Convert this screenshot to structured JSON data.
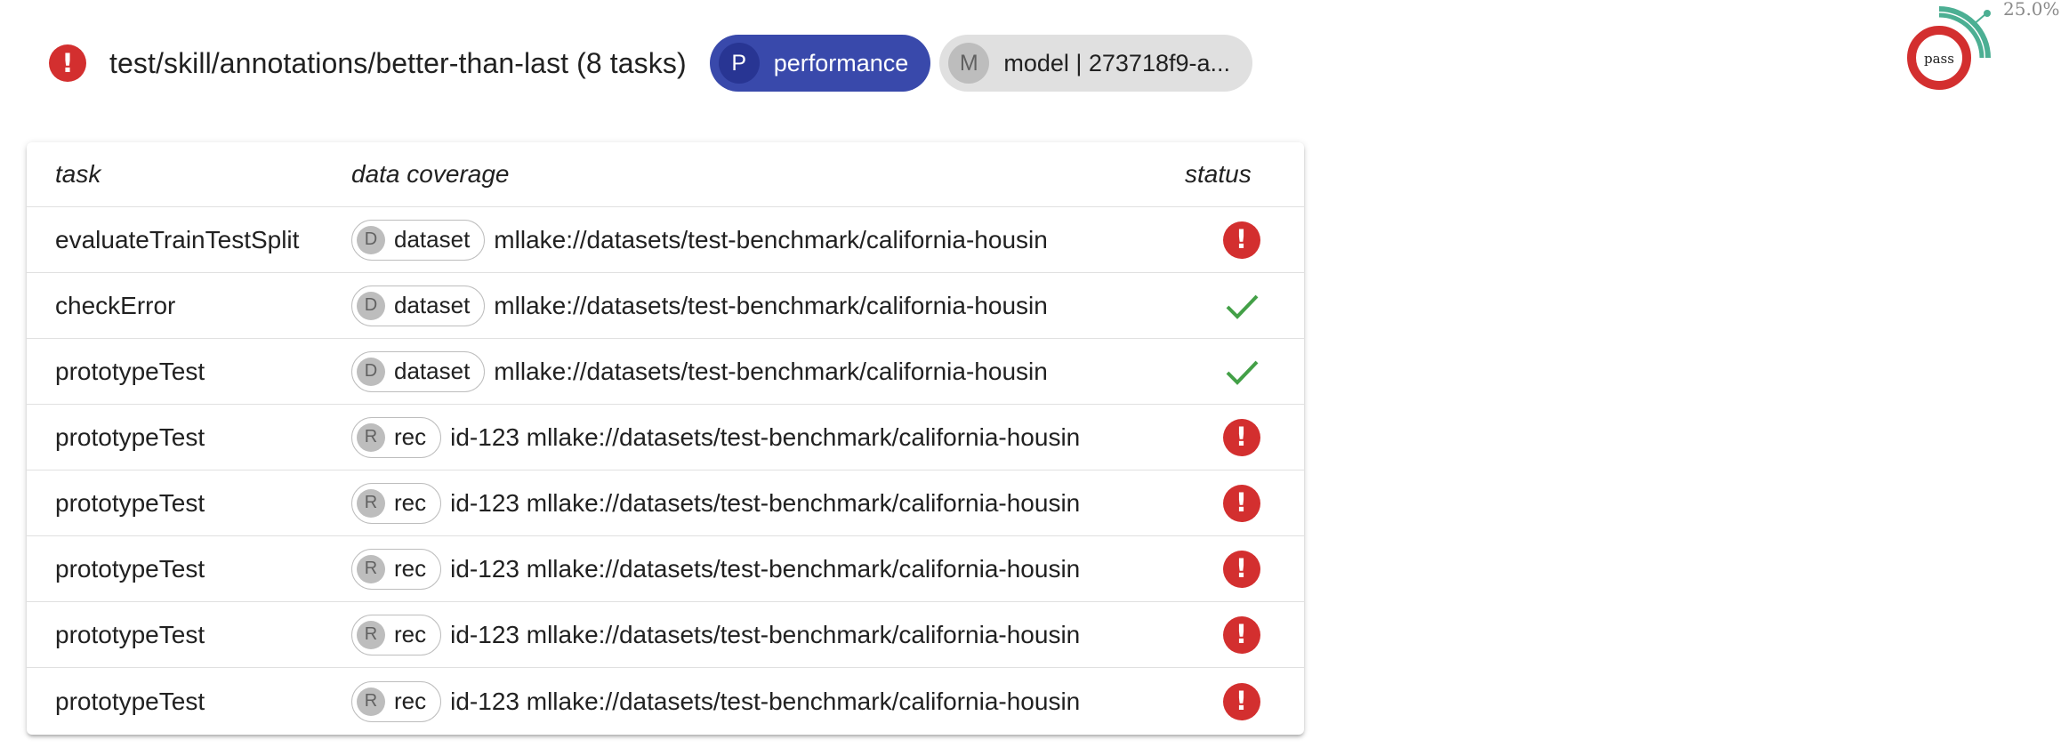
{
  "header": {
    "status_icon": "error-icon",
    "title": "test/skill/annotations/better-than-last (8 tasks)",
    "chips": [
      {
        "avatar": "P",
        "label": "performance"
      },
      {
        "avatar": "M",
        "label": "model | 273718f9-a..."
      }
    ]
  },
  "gauge": {
    "label": "pass",
    "percent_text": "25.0%",
    "pass_fraction": 0.25,
    "colors": {
      "fail": "#d32f2f",
      "pass": "#4caf93"
    }
  },
  "table": {
    "columns": [
      "task",
      "data coverage",
      "status"
    ],
    "rows": [
      {
        "task": "evaluateTrainTestSplit",
        "chip_avatar": "D",
        "chip_label": "dataset",
        "coverage": "mllake://datasets/test-benchmark/california-housin",
        "status": "error"
      },
      {
        "task": "checkError",
        "chip_avatar": "D",
        "chip_label": "dataset",
        "coverage": "mllake://datasets/test-benchmark/california-housin",
        "status": "pass"
      },
      {
        "task": "prototypeTest",
        "chip_avatar": "D",
        "chip_label": "dataset",
        "coverage": "mllake://datasets/test-benchmark/california-housin",
        "status": "pass"
      },
      {
        "task": "prototypeTest",
        "chip_avatar": "R",
        "chip_label": "rec",
        "coverage": "id-123 mllake://datasets/test-benchmark/california-housin",
        "status": "error"
      },
      {
        "task": "prototypeTest",
        "chip_avatar": "R",
        "chip_label": "rec",
        "coverage": "id-123 mllake://datasets/test-benchmark/california-housin",
        "status": "error"
      },
      {
        "task": "prototypeTest",
        "chip_avatar": "R",
        "chip_label": "rec",
        "coverage": "id-123 mllake://datasets/test-benchmark/california-housin",
        "status": "error"
      },
      {
        "task": "prototypeTest",
        "chip_avatar": "R",
        "chip_label": "rec",
        "coverage": "id-123 mllake://datasets/test-benchmark/california-housin",
        "status": "error"
      },
      {
        "task": "prototypeTest",
        "chip_avatar": "R",
        "chip_label": "rec",
        "coverage": "id-123 mllake://datasets/test-benchmark/california-housin",
        "status": "error"
      }
    ]
  }
}
